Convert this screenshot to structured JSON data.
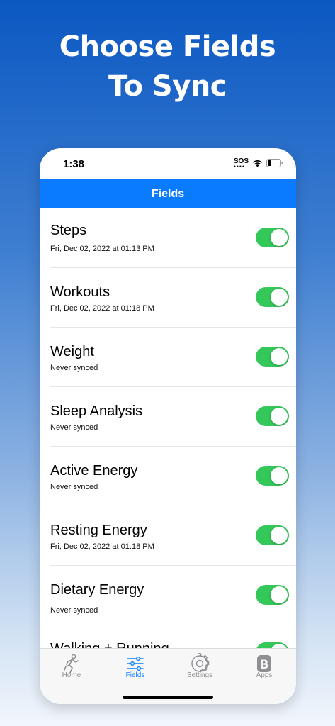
{
  "headline": {
    "line1": "Choose Fields",
    "line2": "To Sync"
  },
  "status_bar": {
    "time": "1:38",
    "sos": "SOS"
  },
  "navbar": {
    "title": "Fields"
  },
  "fields": [
    {
      "name": "Steps",
      "status": "Fri, Dec 02, 2022 at 01:13 PM",
      "enabled": true
    },
    {
      "name": "Workouts",
      "status": "Fri, Dec 02, 2022 at 01:18 PM",
      "enabled": true
    },
    {
      "name": "Weight",
      "status": "Never synced",
      "enabled": true
    },
    {
      "name": "Sleep Analysis",
      "status": "Never synced",
      "enabled": true
    },
    {
      "name": "Active Energy",
      "status": "Never synced",
      "enabled": true
    },
    {
      "name": "Resting Energy",
      "status": "Fri, Dec 02, 2022 at 01:18 PM",
      "enabled": true
    },
    {
      "name": "Dietary Energy",
      "status": "Never synced",
      "enabled": true
    },
    {
      "name": "Walking + Running",
      "status": "",
      "enabled": true
    }
  ],
  "tabs": [
    {
      "label": "Home",
      "icon": "running-person-icon",
      "active": false
    },
    {
      "label": "Fields",
      "icon": "sliders-icon",
      "active": true
    },
    {
      "label": "Settings",
      "icon": "gear-icon",
      "active": false
    },
    {
      "label": "Apps",
      "icon": "apps-b-icon",
      "active": false
    }
  ],
  "colors": {
    "accent": "#0a7bff",
    "toggle_on": "#34c759"
  }
}
